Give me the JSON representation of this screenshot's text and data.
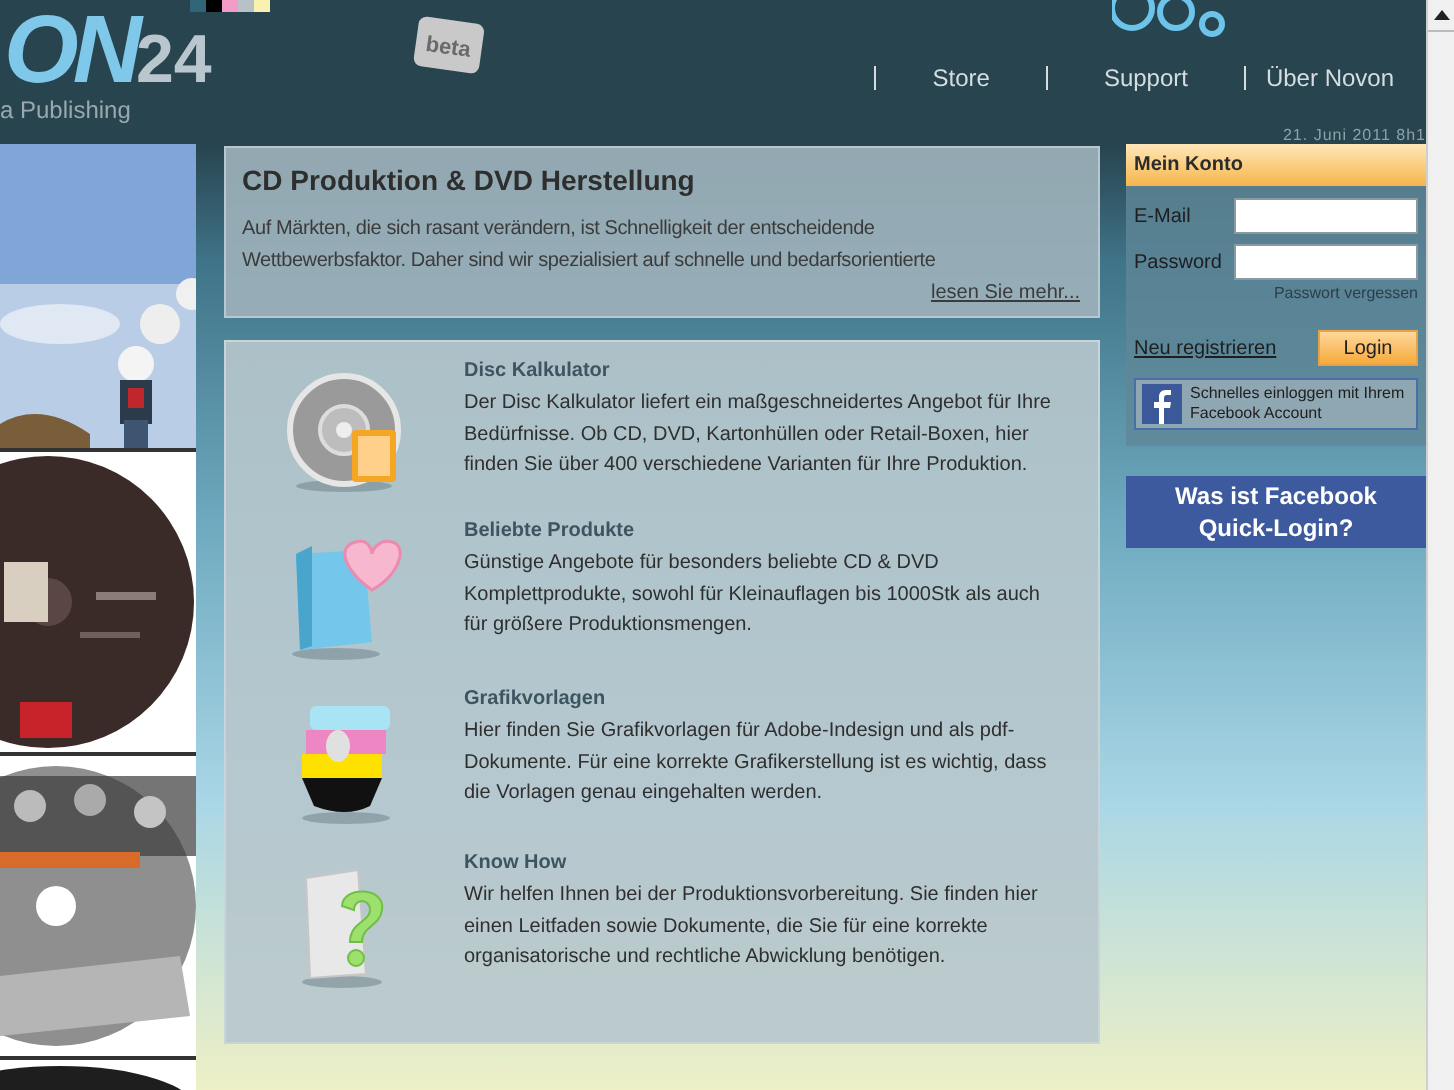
{
  "logo": {
    "word": "ON",
    "number": "24",
    "tagline": "a Publishing"
  },
  "beta_tag": "beta",
  "nav": [
    {
      "label": "Store"
    },
    {
      "label": "Support"
    },
    {
      "label": "Über Novon"
    }
  ],
  "date": "21. Juni 2011 8h1",
  "intro": {
    "title": "CD Produktion & DVD Herstellung",
    "text": "Auf Märkten, die sich rasant verändern, ist Schnelligkeit der entscheidende Wettbewerbsfaktor. Daher sind wir spezialisiert auf schnelle und bedarfsorientierte",
    "more_link": "lesen Sie mehr..."
  },
  "features": [
    {
      "kind": "calculator",
      "title": "Disc Kalkulator",
      "text": "Der Disc Kalkulator liefert ein maßgeschneidertes Angebot für Ihre Bedürfnisse. Ob CD, DVD, Kartonhüllen oder Retail-Boxen, hier finden Sie über 400 verschiedene Varianten für Ihre Produktion."
    },
    {
      "kind": "favorite",
      "title": "Beliebte Produkte",
      "text": "Günstige Angebote für besonders beliebte CD & DVD Komplettprodukte, sowohl für Kleinauflagen bis 1000Stk als auch für größere Produktionsmengen."
    },
    {
      "kind": "templates",
      "title": "Grafikvorlagen",
      "text": "Hier finden Sie Grafikvorlagen für Adobe-Indesign und als pdf-Dokumente. Für eine korrekte Grafikerstellung ist es wichtig, dass die Vorlagen genau eingehalten werden."
    },
    {
      "kind": "help",
      "title": "Know How",
      "text": "Wir helfen Ihnen bei der Produktionsvorbereitung. Sie finden hier einen Leitfaden sowie Dokumente, die Sie für eine korrekte organisatorische und rechtliche Abwicklung benötigen."
    }
  ],
  "account": {
    "title": "Mein Konto",
    "email_label": "E-Mail",
    "password_label": "Password",
    "forgot_link": "Passwort vergessen",
    "register_link": "Neu registrieren",
    "login_button": "Login",
    "facebook_text": "Schnelles einloggen mit Ihrem Facebook Account"
  },
  "facebook_banner": {
    "line_1": "Was ist Facebook",
    "line_2": "Quick-Login?"
  }
}
